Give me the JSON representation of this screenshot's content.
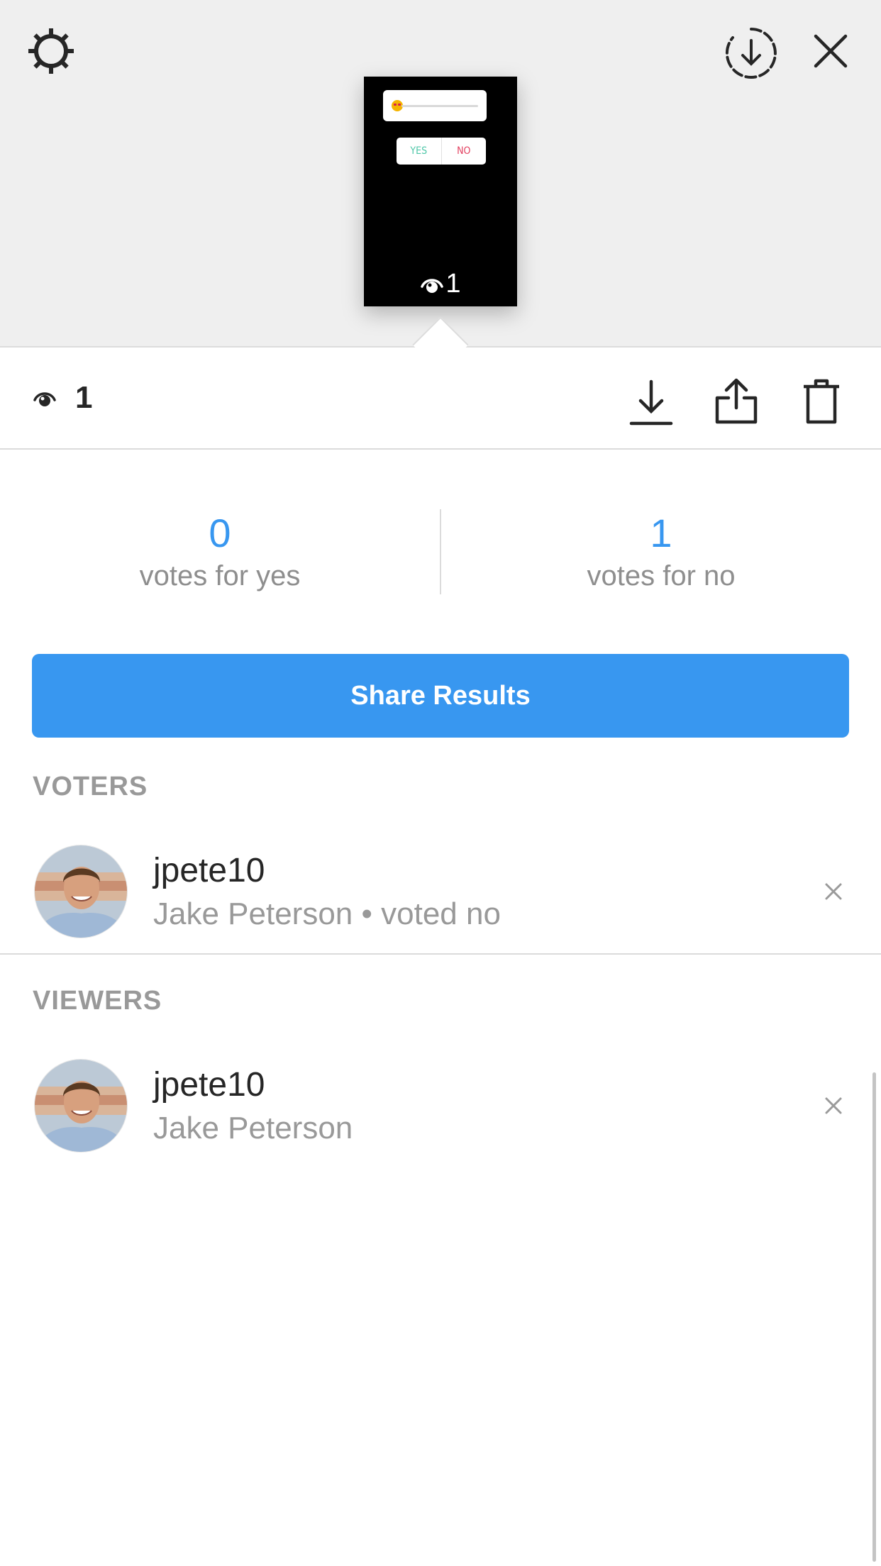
{
  "header": {
    "settings_icon": "gear-icon",
    "save_story_icon": "download-circle-icon",
    "close_icon": "close-icon"
  },
  "story_thumbnail": {
    "poll_yes_label": "YES",
    "poll_no_label": "NO",
    "slider_emoji": "heart-eyes-emoji",
    "view_count": "1"
  },
  "action_bar": {
    "view_count": "1",
    "download_icon": "download-icon",
    "share_icon": "share-icon",
    "delete_icon": "trash-icon"
  },
  "poll_results": {
    "yes_count": "0",
    "yes_label": "votes for yes",
    "no_count": "1",
    "no_label": "votes for no"
  },
  "share_results_label": "Share Results",
  "voters": {
    "header": "VOTERS",
    "items": [
      {
        "username": "jpete10",
        "subtitle": "Jake Peterson • voted no"
      }
    ]
  },
  "viewers": {
    "header": "VIEWERS",
    "items": [
      {
        "username": "jpete10",
        "subtitle": "Jake Peterson"
      }
    ]
  },
  "colors": {
    "accent": "#3897f0",
    "poll_yes": "#4fc7a8",
    "poll_no": "#e34261",
    "muted_text": "#999999"
  }
}
